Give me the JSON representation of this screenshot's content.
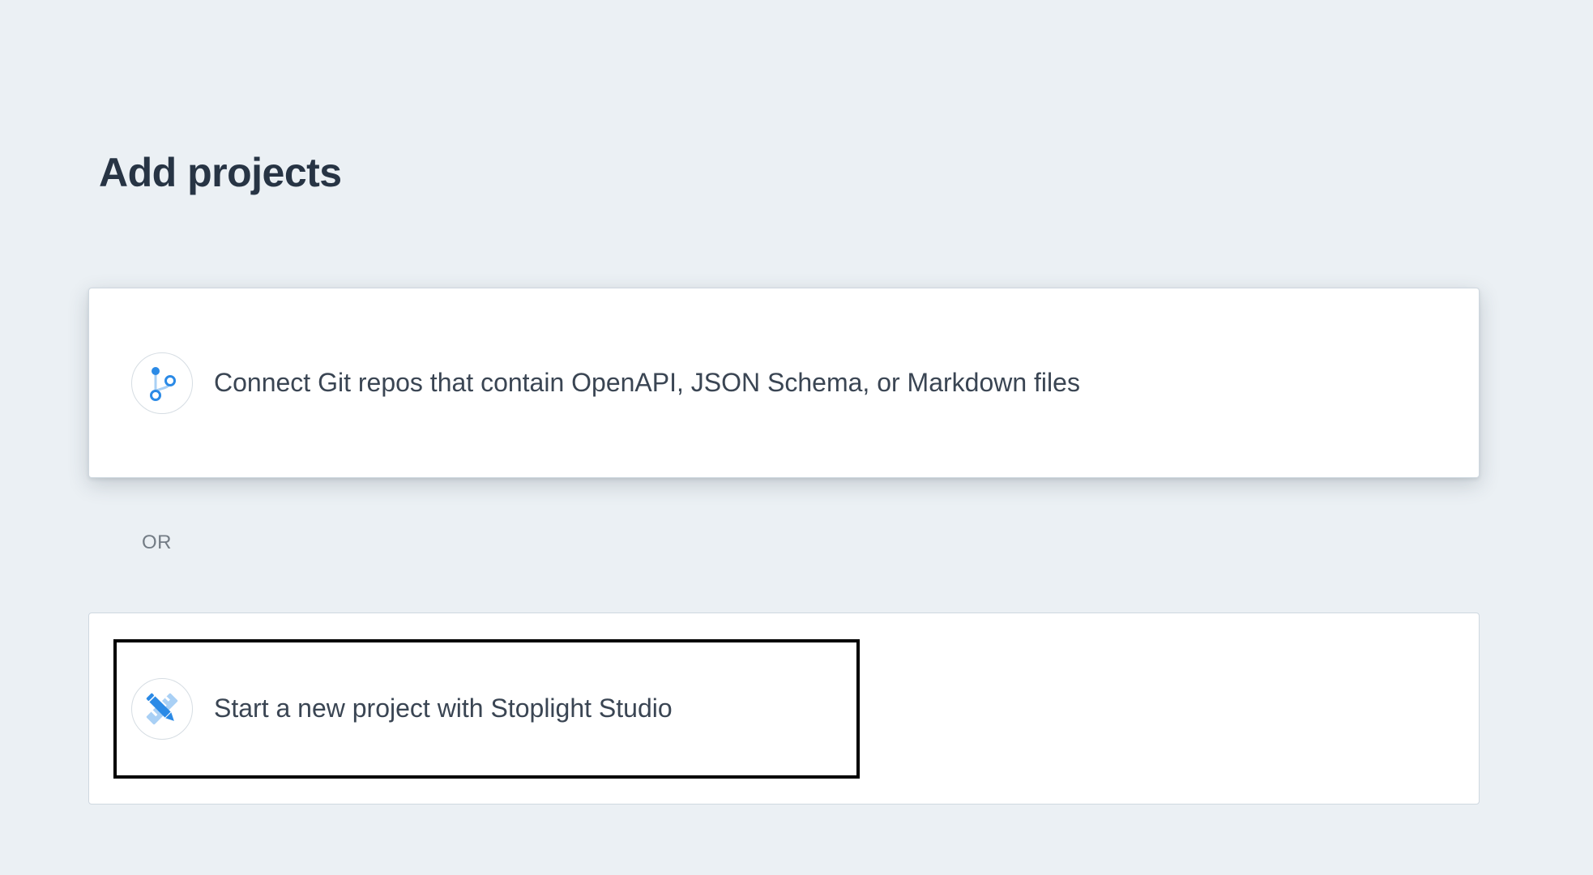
{
  "page": {
    "title": "Add projects"
  },
  "options": {
    "git": {
      "label": "Connect Git repos that contain OpenAPI, JSON Schema, or Markdown files",
      "icon": "git-branch-icon"
    },
    "separator": "OR",
    "studio": {
      "label": "Start a new project with Stoplight Studio",
      "icon": "pencil-ruler-icon"
    }
  },
  "colors": {
    "background": "#ebf0f4",
    "card": "#ffffff",
    "title": "#273444",
    "text": "#3a4553",
    "muted": "#737c85",
    "accent": "#2b8ae6",
    "accent_light": "#a9d0f5",
    "focus_outline": "#000000"
  }
}
